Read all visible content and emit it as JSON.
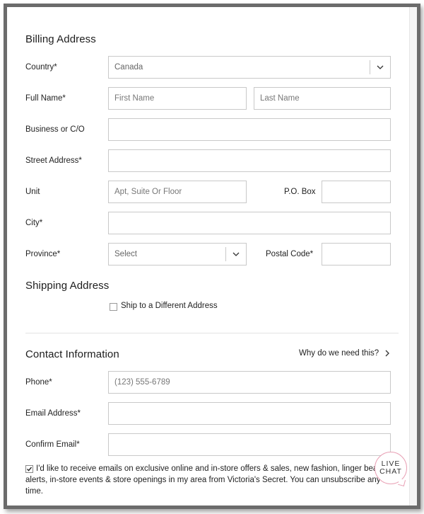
{
  "billing": {
    "title": "Billing Address",
    "country_label": "Country*",
    "country_value": "Canada",
    "fullname_label": "Full Name*",
    "first_name_placeholder": "First Name",
    "last_name_placeholder": "Last Name",
    "business_label": "Business or C/O",
    "street_label": "Street Address*",
    "unit_label": "Unit",
    "unit_placeholder": "Apt, Suite Or Floor",
    "pobox_label": "P.O. Box",
    "city_label": "City*",
    "province_label": "Province*",
    "province_value": "Select",
    "postal_label": "Postal Code*"
  },
  "shipping": {
    "title": "Shipping Address",
    "different_address_label": "Ship to a Different Address",
    "different_address_checked": false
  },
  "contact": {
    "title": "Contact Information",
    "why_link": "Why do we need this?",
    "phone_label": "Phone*",
    "phone_placeholder": "(123) 555-6789",
    "email_label": "Email Address*",
    "confirm_email_label": "Confirm Email*",
    "consent_text": "I'd like to receive emails on exclusive online and in-store offers & sales, new fashion, linger beauty alerts, in-store events & store openings in my area from Victoria's Secret. You can unsubscribe any time.",
    "consent_checked": true
  },
  "live_chat": {
    "line1": "LIVE",
    "line2": "CHAT",
    "accent_color": "#e9a2b6"
  },
  "icons": [
    "chevron-down-icon",
    "chevron-right-icon",
    "checkmark-icon"
  ]
}
